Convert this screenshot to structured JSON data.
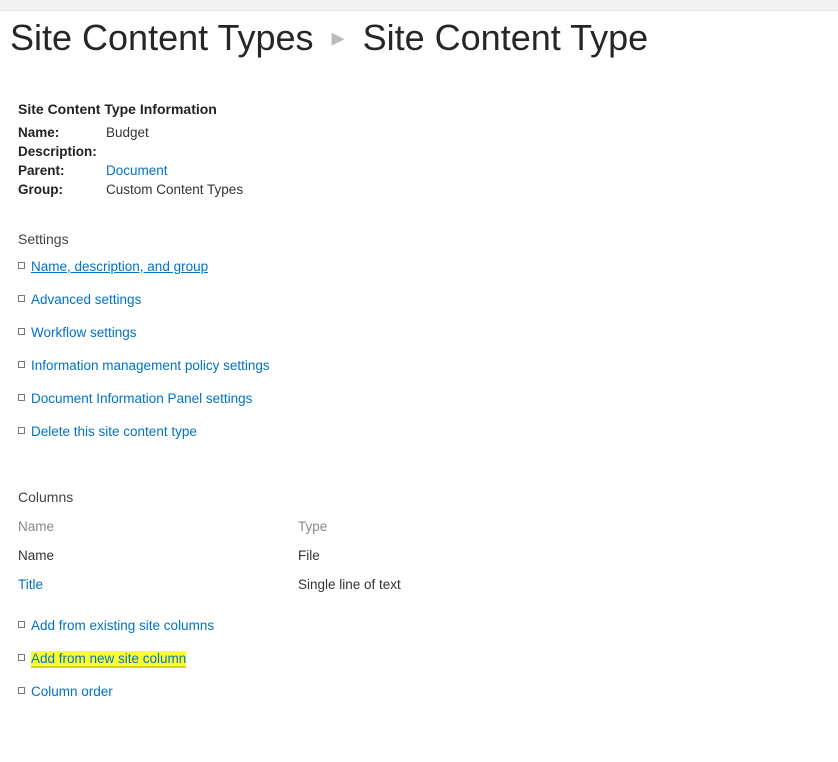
{
  "breadcrumb": {
    "parent": "Site Content Types",
    "current": "Site Content Type"
  },
  "info": {
    "heading": "Site Content Type Information",
    "labels": {
      "name": "Name:",
      "description": "Description:",
      "parent": "Parent:",
      "group": "Group:"
    },
    "values": {
      "name": "Budget",
      "description": "",
      "parent": "Document",
      "group": "Custom Content Types"
    }
  },
  "settings": {
    "heading": "Settings",
    "links": [
      "Name, description, and group",
      "Advanced settings",
      "Workflow settings",
      "Information management policy settings",
      "Document Information Panel settings",
      "Delete this site content type"
    ]
  },
  "columns": {
    "heading": "Columns",
    "header_name": "Name",
    "header_type": "Type",
    "rows": [
      {
        "name": "Name",
        "type": "File",
        "is_link": false
      },
      {
        "name": "Title",
        "type": "Single line of text",
        "is_link": true
      }
    ],
    "actions": [
      "Add from existing site columns",
      "Add from new site column",
      "Column order"
    ]
  }
}
